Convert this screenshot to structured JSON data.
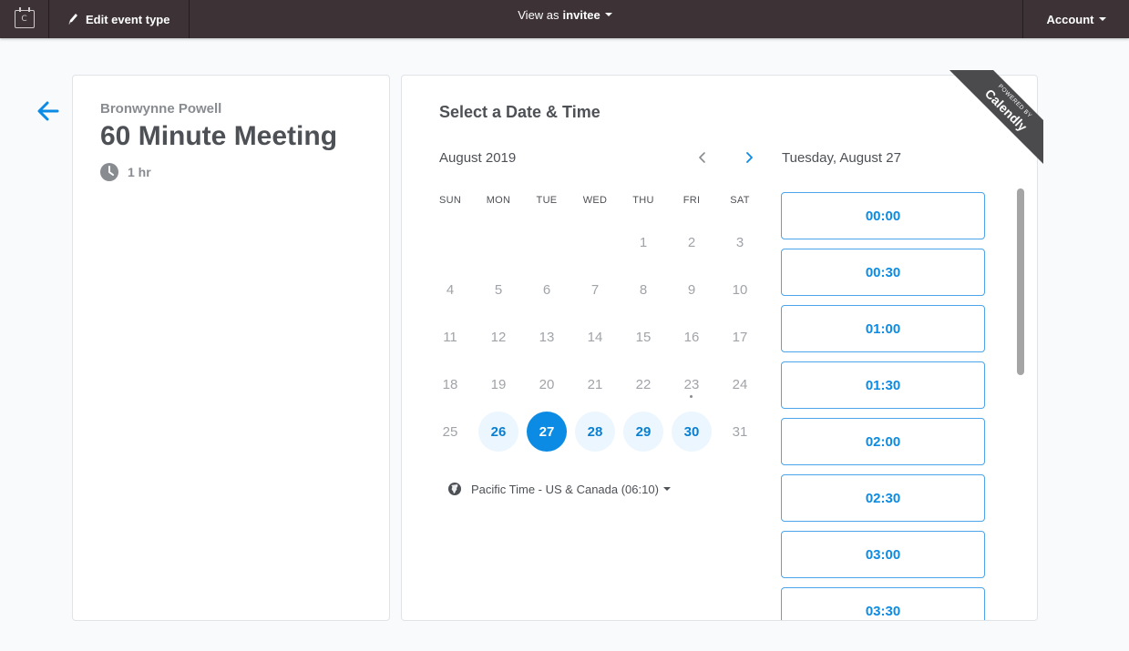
{
  "topbar": {
    "logo_icon": "calendar-icon",
    "logo_glyph": "C",
    "edit_label": "Edit event type",
    "view_prefix": "View as",
    "view_role": "invitee",
    "account_label": "Account"
  },
  "event": {
    "host": "Bronwynne Powell",
    "title": "60 Minute Meeting",
    "duration": "1 hr"
  },
  "scheduler": {
    "title": "Select a Date & Time",
    "month": "August 2019",
    "weekdays": [
      "SUN",
      "MON",
      "TUE",
      "WED",
      "THU",
      "FRI",
      "SAT"
    ],
    "selected_date_label": "Tuesday, August 27",
    "timezone": "Pacific Time - US & Canada (06:10)",
    "days": [
      {
        "d": "1",
        "state": "off"
      },
      {
        "d": "2",
        "state": "off"
      },
      {
        "d": "3",
        "state": "off"
      },
      {
        "d": "4",
        "state": "off"
      },
      {
        "d": "5",
        "state": "off"
      },
      {
        "d": "6",
        "state": "off"
      },
      {
        "d": "7",
        "state": "off"
      },
      {
        "d": "8",
        "state": "off"
      },
      {
        "d": "9",
        "state": "off"
      },
      {
        "d": "10",
        "state": "off"
      },
      {
        "d": "11",
        "state": "off"
      },
      {
        "d": "12",
        "state": "off"
      },
      {
        "d": "13",
        "state": "off"
      },
      {
        "d": "14",
        "state": "off"
      },
      {
        "d": "15",
        "state": "off"
      },
      {
        "d": "16",
        "state": "off"
      },
      {
        "d": "17",
        "state": "off"
      },
      {
        "d": "18",
        "state": "off"
      },
      {
        "d": "19",
        "state": "off"
      },
      {
        "d": "20",
        "state": "off"
      },
      {
        "d": "21",
        "state": "off"
      },
      {
        "d": "22",
        "state": "off"
      },
      {
        "d": "23",
        "state": "today"
      },
      {
        "d": "24",
        "state": "off"
      },
      {
        "d": "25",
        "state": "off"
      },
      {
        "d": "26",
        "state": "available"
      },
      {
        "d": "27",
        "state": "selected"
      },
      {
        "d": "28",
        "state": "available"
      },
      {
        "d": "29",
        "state": "available"
      },
      {
        "d": "30",
        "state": "available"
      },
      {
        "d": "31",
        "state": "off"
      }
    ],
    "time_slots": [
      "00:00",
      "00:30",
      "01:00",
      "01:30",
      "02:00",
      "02:30",
      "03:00",
      "03:30"
    ]
  },
  "ribbon": {
    "small": "POWERED BY",
    "brand": "Calendly"
  },
  "colors": {
    "topbar": "#3d3336",
    "accent": "#0b8be3",
    "available_bg": "#ebf6fe"
  }
}
